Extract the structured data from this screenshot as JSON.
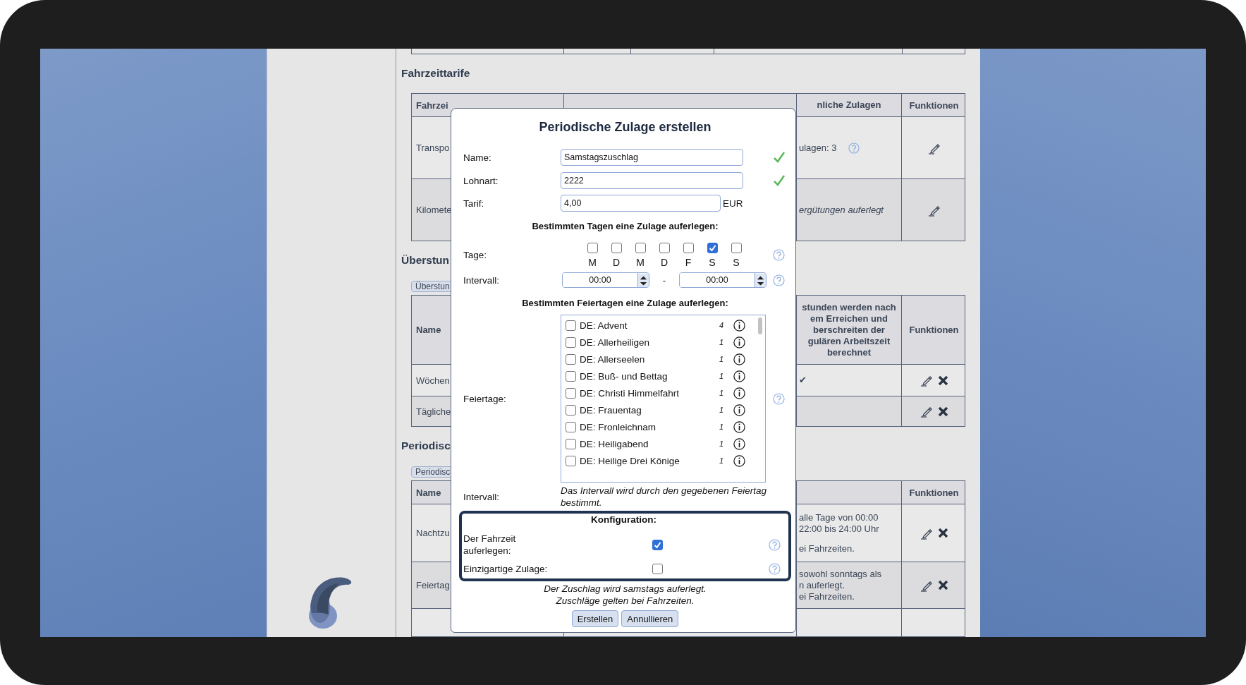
{
  "sections": [
    {
      "heading": "Fahrzeittarife",
      "header": {
        "column_1": "Fahrzei",
        "column_3": [
          "nliche Zulagen"
        ],
        "functions": "Funktionen"
      },
      "rows": [
        {
          "column_1": "Transpo",
          "column_3": {
            "paragraphs": [
              "ulagen: 3"
            ],
            "help": true
          },
          "editable": true
        },
        {
          "column_1": "Kilomete",
          "column_3": {
            "paragraphs": [
              "ergütungen auferlegt"
            ],
            "italic": true
          },
          "editable": true
        }
      ]
    },
    {
      "heading": "Überstun",
      "button": "Überstun",
      "header": {
        "column_1": "Name",
        "column_3": [
          "stunden werden nach\nem Erreichen und\nberschreiten der\ngulären Arbeitszeit\nberechnet"
        ],
        "functions": "Funktionen"
      },
      "rows": [
        {
          "column_1": "Wöchen",
          "column_3": {
            "paragraphs": [
              "✔"
            ]
          },
          "editable": true,
          "deletable": true
        },
        {
          "column_1": "Tägliche",
          "editable": true,
          "deletable": true
        }
      ]
    },
    {
      "heading": "Periodisc",
      "button": "Periodisc",
      "header": {
        "column_1": "Name",
        "functions": "Funktionen"
      },
      "rows": [
        {
          "column_1": "Nachtzu",
          "column_3": {
            "paragraphs": [
              "alle Tage von 00:00\n22:00 bis 24:00 Uhr",
              "ei Fahrzeiten."
            ]
          },
          "editable": true,
          "deletable": true
        },
        {
          "column_1": "Feiertag",
          "column_3": {
            "paragraphs": [
              "sowohl sonntags als\nn auferlegt.\nei Fahrzeiten."
            ]
          },
          "editable": true,
          "deletable": true
        }
      ]
    }
  ],
  "modal": {
    "title": "Periodische Zulage erstellen",
    "fields": [
      {
        "label": "Name:",
        "value": "Samstagszuschlag",
        "valid": true
      },
      {
        "label": "Lohnart:",
        "value": "2222",
        "valid": true
      },
      {
        "label": "Tarif:",
        "value": "4,00",
        "unit": "EUR"
      }
    ],
    "days_heading": "Bestimmten Tagen eine Zulage auferlegen:",
    "days": {
      "label": "Tage:",
      "items": [
        {
          "letter": "M",
          "checked": false
        },
        {
          "letter": "D",
          "checked": false
        },
        {
          "letter": "M",
          "checked": false
        },
        {
          "letter": "D",
          "checked": false
        },
        {
          "letter": "F",
          "checked": false
        },
        {
          "letter": "S",
          "checked": true
        },
        {
          "letter": "S",
          "checked": false
        }
      ]
    },
    "interval": {
      "label": "Intervall:",
      "from": "00:00",
      "separator": "-",
      "to": "00:00"
    },
    "holidays_heading": "Bestimmten Feiertagen eine Zulage auferlegen:",
    "holidays": {
      "label": "Feiertage:",
      "items": [
        {
          "name": "DE: Advent",
          "count": "4",
          "checked": false
        },
        {
          "name": "DE: Allerheiligen",
          "count": "1",
          "checked": false
        },
        {
          "name": "DE: Allerseelen",
          "count": "1",
          "checked": false
        },
        {
          "name": "DE: Buß- und Bettag",
          "count": "1",
          "checked": false
        },
        {
          "name": "DE: Christi Himmelfahrt",
          "count": "1",
          "checked": false
        },
        {
          "name": "DE: Frauentag",
          "count": "1",
          "checked": false
        },
        {
          "name": "DE: Fronleichnam",
          "count": "1",
          "checked": false
        },
        {
          "name": "DE: Heiligabend",
          "count": "1",
          "checked": false
        },
        {
          "name": "DE: Heilige Drei Könige",
          "count": "1",
          "checked": false
        }
      ]
    },
    "holiday_interval": {
      "label": "Intervall:",
      "note": "Das Intervall wird durch den gegebenen Feiertag bestimmt."
    },
    "configuration": {
      "heading": "Konfiguration:",
      "options": [
        {
          "label": "Der Fahrzeit auferlegen:",
          "checked": true
        },
        {
          "label": "Einzigartige Zulage:",
          "checked": false
        }
      ]
    },
    "summary": [
      "Der Zuschlag wird samstags auferlegt.",
      "Zuschläge gelten bei Fahrzeiten."
    ],
    "buttons": [
      "Erstellen",
      "Annullieren"
    ]
  }
}
